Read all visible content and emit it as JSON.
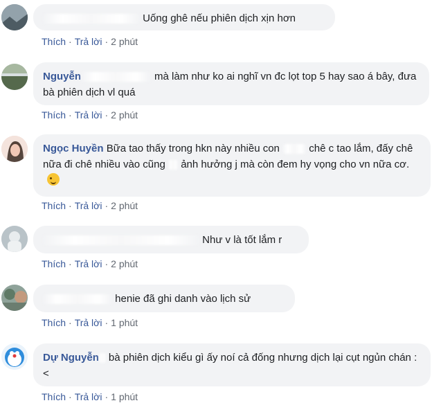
{
  "actions": {
    "like": "Thích",
    "reply": "Trả lời",
    "sep": "·"
  },
  "comments": [
    {
      "name": "",
      "text": "Uống ghê nếu phiên dịch xịn hơn",
      "time": "2 phút"
    },
    {
      "name": "Nguyễn",
      "text": "mà làm như ko ai nghĩ vn đc lọt top 5 hay sao á bây, đưa bà phiên dịch vl quá",
      "time": "2 phút"
    },
    {
      "name": "Ngọc Huyền",
      "text_a": "Bữa tao thấy trong hkn này nhiều con",
      "text_b": "chê c tao lắm, đấy chê nữa đi chê nhiều vào cũng",
      "text_c": "ảnh hưởng j mà còn đem hy vọng cho vn nữa cơ.",
      "time": "2 phút"
    },
    {
      "name": "",
      "text": "Như v là tốt lắm r",
      "time": "2 phút"
    },
    {
      "name": "",
      "text": "henie đã ghi danh vào lịch sử",
      "time": "1 phút"
    },
    {
      "name": "Dự Nguyễn",
      "text": "bà phiên dịch kiểu gì ấy noí cả đống nhưng dịch lại cụt ngủn chán :<",
      "time": "1 phút"
    }
  ],
  "icons": {
    "emoji": "smirk-emoji-icon"
  }
}
